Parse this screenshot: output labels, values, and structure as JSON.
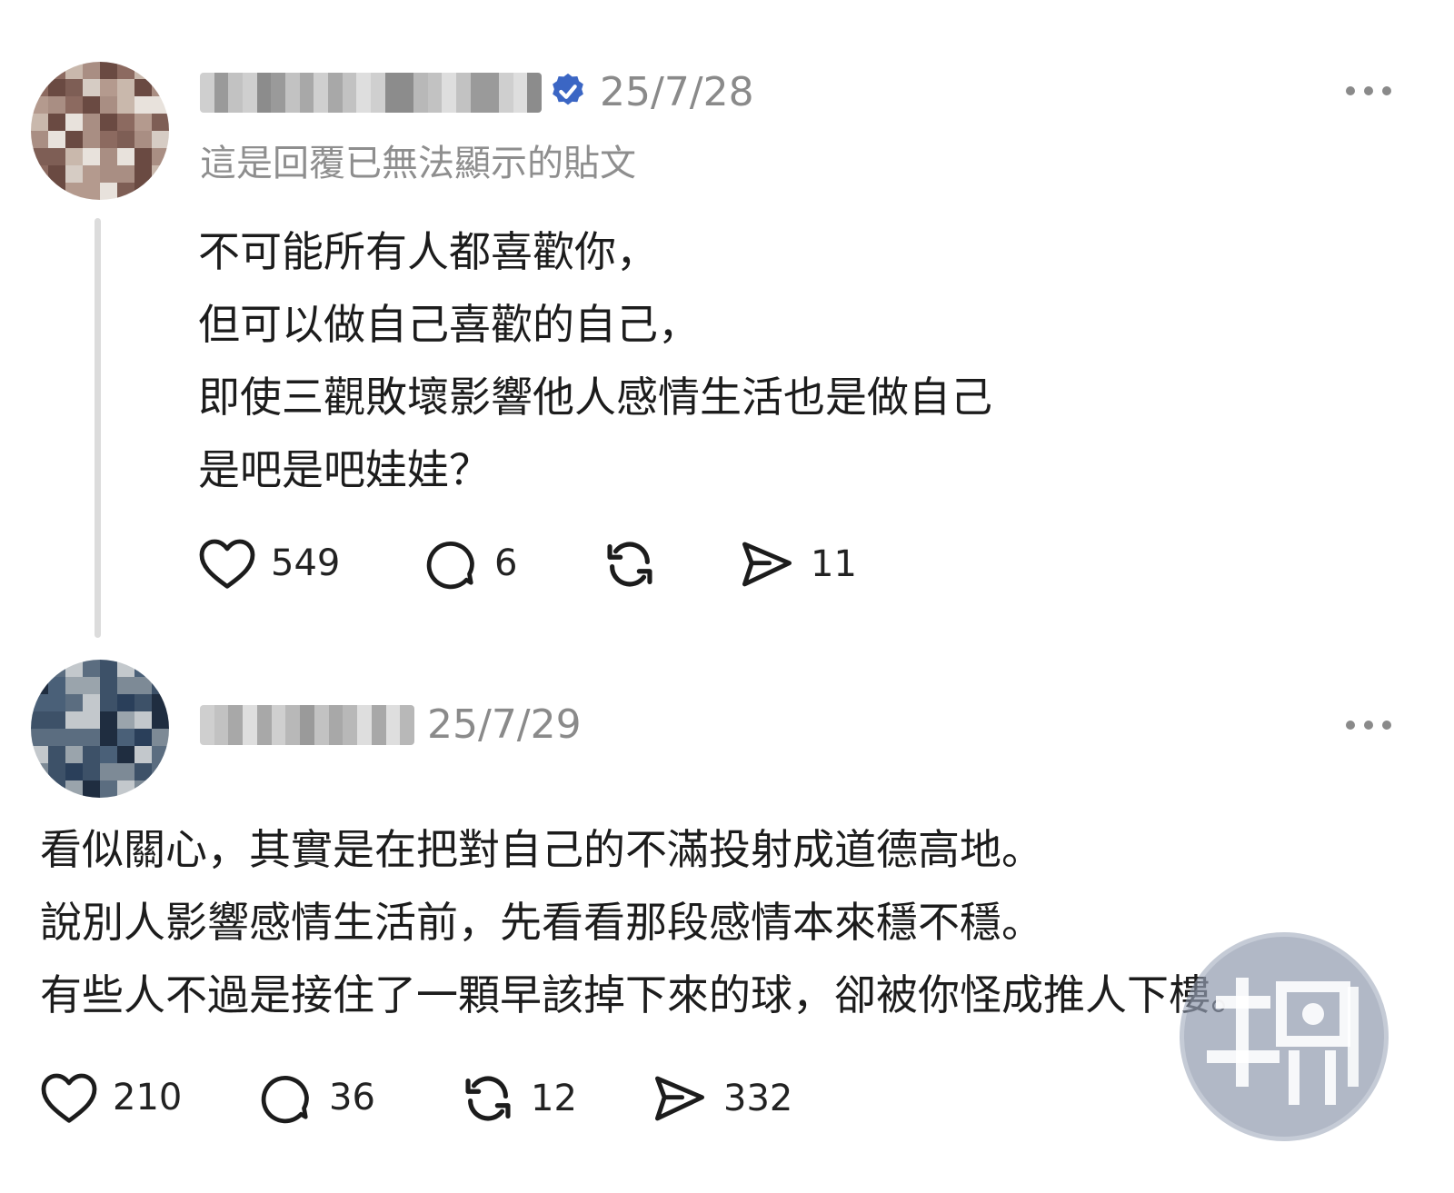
{
  "posts": [
    {
      "date": "25/7/28",
      "verified": true,
      "context": "這是回覆已無法顯示的貼文",
      "lines": [
        "不可能所有人都喜歡你，",
        "但可以做自己喜歡的自己，",
        "即使三觀敗壞影響他人感情生活也是做自己",
        "是吧是吧娃娃？"
      ],
      "actions": {
        "likes": "549",
        "replies": "6",
        "reposts": "",
        "shares": "11"
      },
      "avatar_colors": [
        "#c9b8ac",
        "#a98e83",
        "#7e5e55",
        "#6a4a42",
        "#8c6a60",
        "#b49a8e",
        "#d6ccc4",
        "#e8e2dc"
      ]
    },
    {
      "date": "25/7/29",
      "verified": false,
      "lines": [
        "看似關心，其實是在把對自己的不滿投射成道德高地。",
        "說別人影響感情生活前，先看看那段感情本來穩不穩。",
        "有些人不過是接住了一顆早該掉下來的球，卻被你怪成推人下樓。"
      ],
      "actions": {
        "likes": "210",
        "replies": "36",
        "reposts": "12",
        "shares": "332"
      },
      "avatar_colors": [
        "#3d5168",
        "#2a3f5a",
        "#4a6078",
        "#1f2d40",
        "#5b6d80",
        "#7d8a96",
        "#9aa4ac",
        "#c3c8cc"
      ]
    }
  ],
  "more_icon": "more-horizontal-icon",
  "watermark_text": "鏡週刊",
  "colors": {
    "verified": "#3b66c4",
    "muted": "#8a8a8a",
    "thread": "#dcdcdc"
  }
}
